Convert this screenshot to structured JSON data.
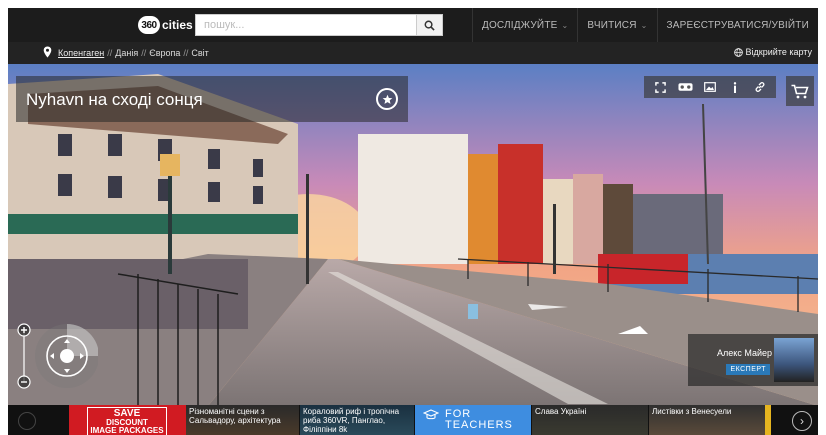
{
  "header": {
    "logo_number": "360",
    "logo_text": "cities",
    "search_placeholder": "пошук...",
    "nav": [
      {
        "label": "ДОСЛІДЖУЙТЕ",
        "has_dropdown": true
      },
      {
        "label": "ВЧИТИСЯ",
        "has_dropdown": true
      },
      {
        "label": "ЗАРЕЄСТРУВАТИСЯ/УВІЙТИ",
        "has_dropdown": false
      }
    ]
  },
  "breadcrumb": {
    "items": [
      "Копенгаген",
      "Данія",
      "Європа",
      "Світ"
    ],
    "separator": "//",
    "open_map": "Відкрийте карту"
  },
  "panorama": {
    "title": "Nyhavn на сході сонця",
    "tools": [
      "fullscreen-icon",
      "vr-headset-icon",
      "image-icon",
      "info-icon",
      "link-icon"
    ],
    "cart_icon": "cart-icon",
    "author": {
      "name": "Алекс Майер",
      "badge": "ЕКСПЕРТ"
    }
  },
  "strip": {
    "ad": {
      "line1": "SAVE",
      "line2": "DISCOUNT",
      "line3": "IMAGE PACKAGES"
    },
    "thumbs": [
      "Різноманітні сцени з Сальвадору, архітектура",
      "Кораловий риф і тропічна риба 360VR, Панглао, Філіппіни 8k",
      "Слава Україні",
      "Листівки з Венесуели"
    ],
    "teachers": {
      "line1": "FOR",
      "line2": "TEACHERS"
    }
  },
  "colors": {
    "topbar": "#1c1c1c",
    "crumbbar": "#232323",
    "ad_red": "#d11b22",
    "teachers_blue": "#3e8de0",
    "expert_badge": "#2a79b8"
  }
}
